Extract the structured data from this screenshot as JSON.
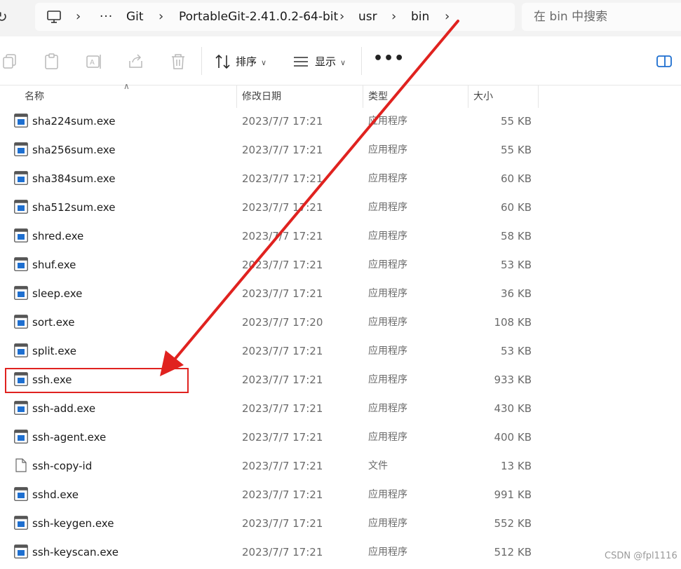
{
  "breadcrumb": {
    "overflow": "···",
    "items": [
      "Git",
      "PortableGit-2.41.0.2-64-bit",
      "usr",
      "bin"
    ],
    "separator": "›"
  },
  "search": {
    "placeholder": "在 bin 中搜索"
  },
  "toolbar": {
    "sort_label": "排序",
    "view_label": "显示",
    "more_label": "•••",
    "icons": [
      "copy-icon",
      "paste-icon",
      "rename-icon",
      "share-icon",
      "delete-icon",
      "sort-icon",
      "view-icon",
      "details-pane-icon"
    ]
  },
  "columns": {
    "name": "名称",
    "modified": "修改日期",
    "type": "类型",
    "size": "大小"
  },
  "files": [
    {
      "name": "sha224sum.exe",
      "date": "2023/7/7 17:21",
      "type": "应用程序",
      "size": "55 KB",
      "icon": "app"
    },
    {
      "name": "sha256sum.exe",
      "date": "2023/7/7 17:21",
      "type": "应用程序",
      "size": "55 KB",
      "icon": "app"
    },
    {
      "name": "sha384sum.exe",
      "date": "2023/7/7 17:21",
      "type": "应用程序",
      "size": "60 KB",
      "icon": "app"
    },
    {
      "name": "sha512sum.exe",
      "date": "2023/7/7 17:21",
      "type": "应用程序",
      "size": "60 KB",
      "icon": "app"
    },
    {
      "name": "shred.exe",
      "date": "2023/7/7 17:21",
      "type": "应用程序",
      "size": "58 KB",
      "icon": "app"
    },
    {
      "name": "shuf.exe",
      "date": "2023/7/7 17:21",
      "type": "应用程序",
      "size": "53 KB",
      "icon": "app"
    },
    {
      "name": "sleep.exe",
      "date": "2023/7/7 17:21",
      "type": "应用程序",
      "size": "36 KB",
      "icon": "app"
    },
    {
      "name": "sort.exe",
      "date": "2023/7/7 17:20",
      "type": "应用程序",
      "size": "108 KB",
      "icon": "app"
    },
    {
      "name": "split.exe",
      "date": "2023/7/7 17:21",
      "type": "应用程序",
      "size": "53 KB",
      "icon": "app"
    },
    {
      "name": "ssh.exe",
      "date": "2023/7/7 17:21",
      "type": "应用程序",
      "size": "933 KB",
      "icon": "app"
    },
    {
      "name": "ssh-add.exe",
      "date": "2023/7/7 17:21",
      "type": "应用程序",
      "size": "430 KB",
      "icon": "app"
    },
    {
      "name": "ssh-agent.exe",
      "date": "2023/7/7 17:21",
      "type": "应用程序",
      "size": "400 KB",
      "icon": "app"
    },
    {
      "name": "ssh-copy-id",
      "date": "2023/7/7 17:21",
      "type": "文件",
      "size": "13 KB",
      "icon": "file"
    },
    {
      "name": "sshd.exe",
      "date": "2023/7/7 17:21",
      "type": "应用程序",
      "size": "991 KB",
      "icon": "app"
    },
    {
      "name": "ssh-keygen.exe",
      "date": "2023/7/7 17:21",
      "type": "应用程序",
      "size": "552 KB",
      "icon": "app"
    },
    {
      "name": "ssh-keyscan.exe",
      "date": "2023/7/7 17:21",
      "type": "应用程序",
      "size": "512 KB",
      "icon": "app"
    }
  ],
  "annotation": {
    "highlighted_file": "ssh.exe",
    "color": "#e0221f"
  },
  "watermark": "CSDN @fpl1116",
  "colors": {
    "app_icon_blue": "#1e6fd0",
    "text_secondary": "#6a6a6a"
  }
}
